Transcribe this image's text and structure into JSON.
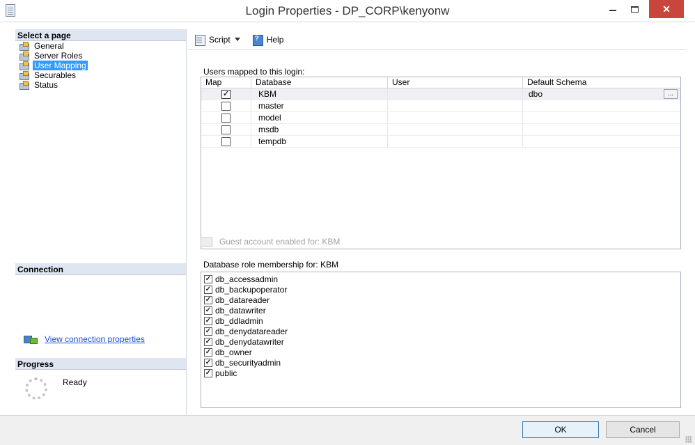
{
  "window": {
    "title": "Login Properties - DP_CORP\\kenyonw",
    "close_label": "✕"
  },
  "left_panel": {
    "select_page_header": "Select a page",
    "pages": [
      {
        "label": "General",
        "selected": false
      },
      {
        "label": "Server Roles",
        "selected": false
      },
      {
        "label": "User Mapping",
        "selected": true
      },
      {
        "label": "Securables",
        "selected": false
      },
      {
        "label": "Status",
        "selected": false
      }
    ],
    "connection_header": "Connection",
    "connection_link": "View connection properties",
    "progress_header": "Progress",
    "progress_status": "Ready"
  },
  "toolbar": {
    "script_label": "Script",
    "help_label": "Help"
  },
  "user_mapping": {
    "users_label": "Users mapped to this login:",
    "columns": [
      "Map",
      "Database",
      "User",
      "Default Schema"
    ],
    "rows": [
      {
        "map": true,
        "database": "KBM",
        "user": "",
        "schema": "dbo",
        "selected": true
      },
      {
        "map": false,
        "database": "master",
        "user": "",
        "schema": ""
      },
      {
        "map": false,
        "database": "model",
        "user": "",
        "schema": ""
      },
      {
        "map": false,
        "database": "msdb",
        "user": "",
        "schema": ""
      },
      {
        "map": false,
        "database": "tempdb",
        "user": "",
        "schema": ""
      }
    ],
    "ellipsis": "...",
    "guest_label": "Guest account enabled for: KBM",
    "roles_label": "Database role membership for: KBM",
    "roles": [
      {
        "name": "db_accessadmin",
        "checked": true
      },
      {
        "name": "db_backupoperator",
        "checked": true
      },
      {
        "name": "db_datareader",
        "checked": true
      },
      {
        "name": "db_datawriter",
        "checked": true
      },
      {
        "name": "db_ddladmin",
        "checked": true
      },
      {
        "name": "db_denydatareader",
        "checked": true
      },
      {
        "name": "db_denydatawriter",
        "checked": true
      },
      {
        "name": "db_owner",
        "checked": true
      },
      {
        "name": "db_securityadmin",
        "checked": true
      },
      {
        "name": "public",
        "checked": true
      }
    ]
  },
  "buttons": {
    "ok": "OK",
    "cancel": "Cancel"
  },
  "colors": {
    "selection": "#3399ff",
    "section_header": "#dfe6f1",
    "close_button": "#c9463d",
    "link": "#1a4fd0"
  }
}
